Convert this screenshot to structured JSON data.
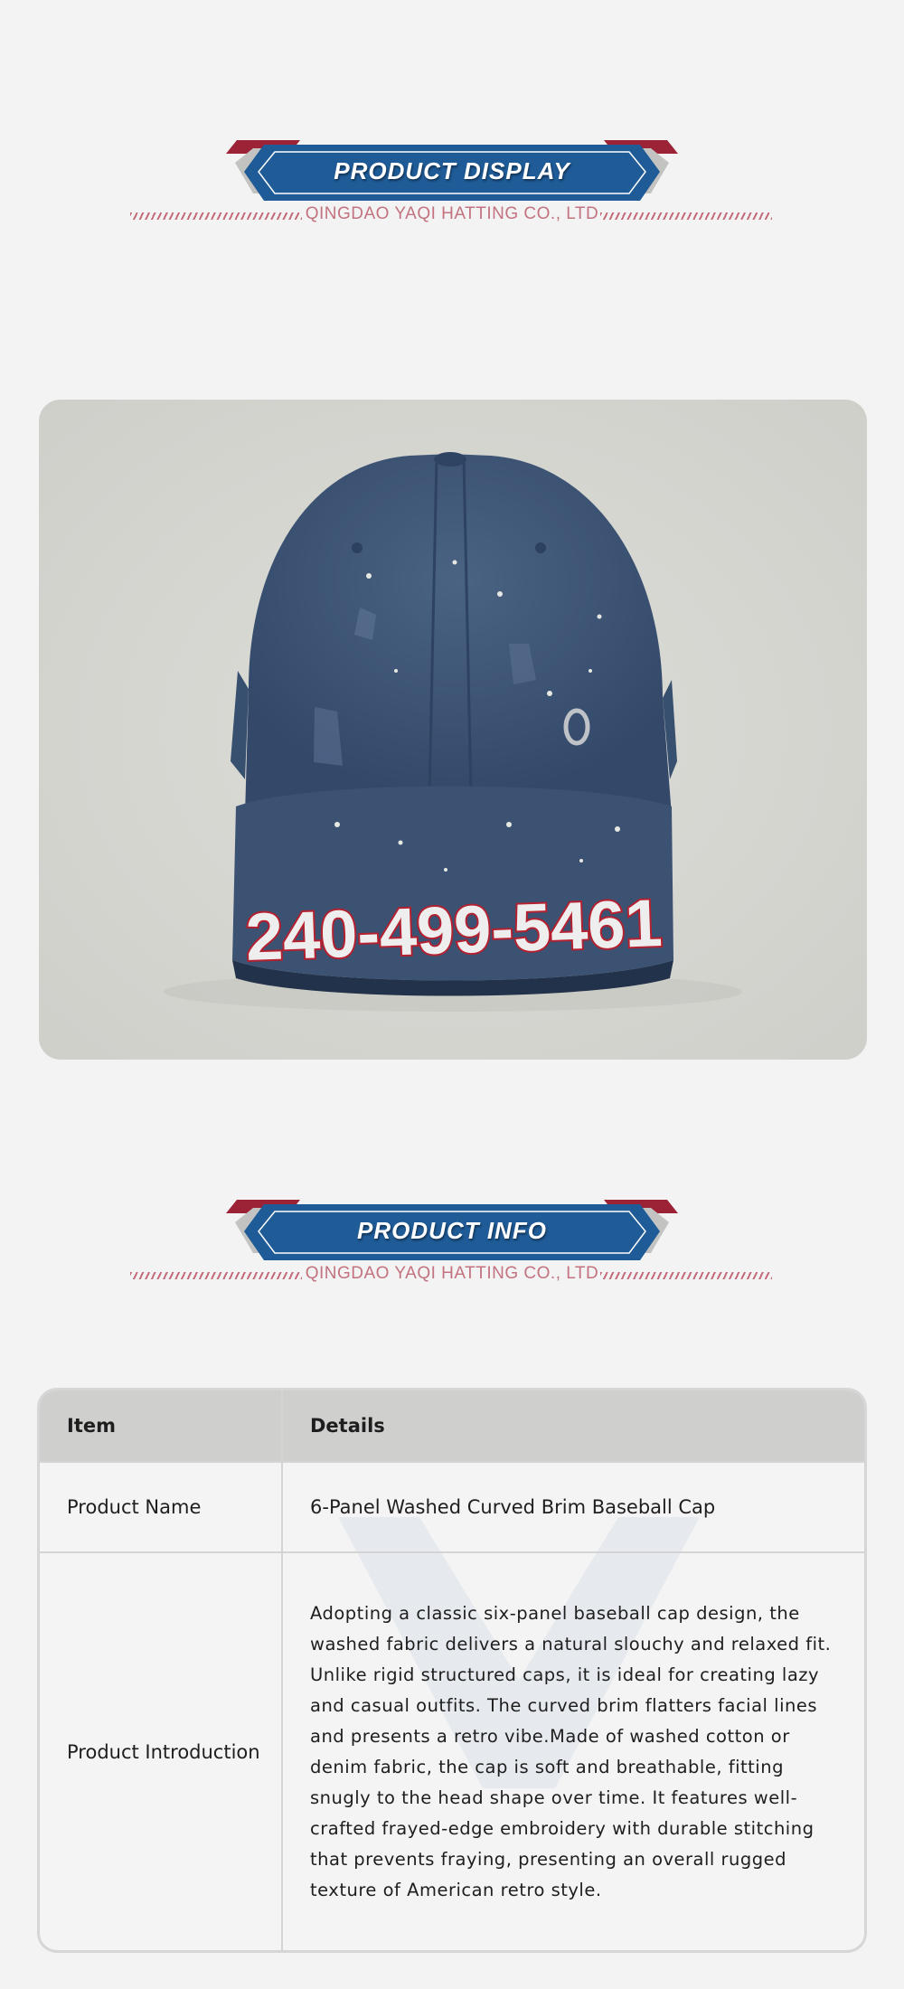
{
  "sections": {
    "display": {
      "title": "PRODUCT DISPLAY",
      "company": "QINGDAO YAQI HATTING CO., LTD"
    },
    "info": {
      "title": "PRODUCT INFO",
      "company": "QINGDAO YAQI HATTING CO., LTD"
    }
  },
  "product_image": {
    "icon": "baseball-cap-image",
    "brim_text": "240-499-5461",
    "cap_color": "#3f5776"
  },
  "colors": {
    "banner_blue": "#1f5b97",
    "banner_red": "#9c2335",
    "banner_gray": "#c3c3c1",
    "company_text": "#c3727f",
    "background": "#f3f3f3"
  },
  "table": {
    "headers": {
      "item": "Item",
      "details": "Details"
    },
    "rows": [
      {
        "item": "Product Name",
        "details": "6-Panel Washed Curved Brim Baseball Cap"
      },
      {
        "item": "Product Introduction",
        "details": "Adopting a classic six-panel baseball cap design, the washed fabric delivers a natural slouchy and relaxed fit. Unlike rigid structured caps, it is ideal for creating lazy and casual outfits. The curved brim flatters facial lines and presents a retro vibe.Made of washed cotton or denim fabric, the cap is soft and breathable, fitting snugly to the head shape over time. It features well-crafted frayed-edge embroidery with durable stitching that prevents fraying, presenting an overall rugged texture of American retro style."
      }
    ]
  }
}
